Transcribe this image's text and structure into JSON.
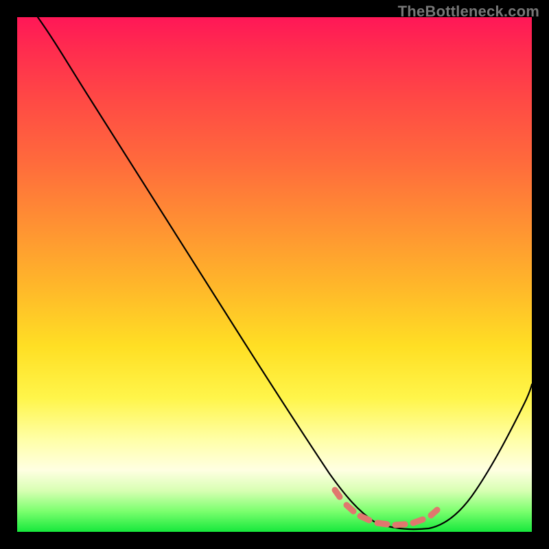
{
  "watermark": "TheBottleneck.com",
  "colors": {
    "page_bg": "#000000",
    "curve": "#000000",
    "dash": "#e0776e",
    "gradient_stops": [
      "#ff1757",
      "#ff2b4f",
      "#ff4945",
      "#ff6a3c",
      "#ff9033",
      "#ffb62a",
      "#ffdf24",
      "#fff54a",
      "#ffffa6",
      "#ffffe2",
      "#d8ffb3",
      "#7bff6e",
      "#16e83c"
    ]
  },
  "chart_data": {
    "type": "line",
    "title": "",
    "xlabel": "",
    "ylabel": "",
    "xlim": [
      0,
      100
    ],
    "ylim": [
      0,
      100
    ],
    "grid": false,
    "legend": false,
    "note": "No numeric axes are shown; y represents a metric that decreases from a peak at the left edge down to a flat minimum near x≈68–80 then rises again. Values are pixel-normalized (0–100 each axis).",
    "series": [
      {
        "name": "curve",
        "x": [
          4,
          8,
          12,
          18,
          26,
          34,
          42,
          50,
          58,
          62,
          66,
          70,
          74,
          78,
          82,
          86,
          90,
          94,
          98,
          100
        ],
        "y": [
          100,
          96,
          91,
          83,
          72,
          60,
          48,
          36,
          24,
          17,
          10,
          5,
          2,
          1,
          2,
          8,
          16,
          24,
          31,
          35
        ]
      }
    ],
    "annotations": [
      {
        "name": "minimum-band-dashes",
        "type": "dashed-segment-row",
        "y": 3,
        "x_start": 63,
        "x_end": 83,
        "color": "#e0776e"
      }
    ]
  }
}
